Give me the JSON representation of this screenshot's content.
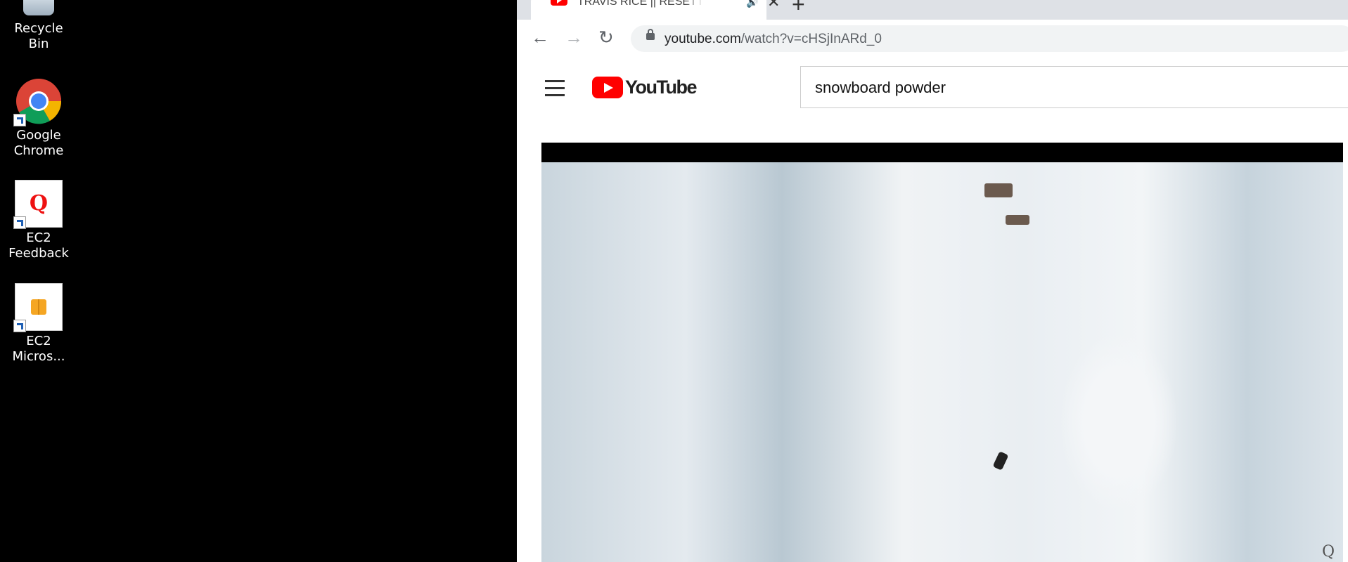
{
  "desktop": {
    "icons": [
      {
        "label": "Recycle Bin"
      },
      {
        "label": "Google Chrome"
      },
      {
        "label": "EC2 Feedback"
      },
      {
        "label": "EC2 Micros..."
      }
    ]
  },
  "browser": {
    "tab": {
      "title": "TRAVIS RICE || RESETTER - YouTube",
      "audio_icon": "speaker-icon",
      "close": "✕"
    },
    "new_tab": "+",
    "address": {
      "host": "youtube.com",
      "path": "/watch?v=cHSjInARd_0"
    }
  },
  "youtube": {
    "logo_text": "YouTube",
    "search_value": "snowboard powder",
    "watermark": "Q"
  }
}
